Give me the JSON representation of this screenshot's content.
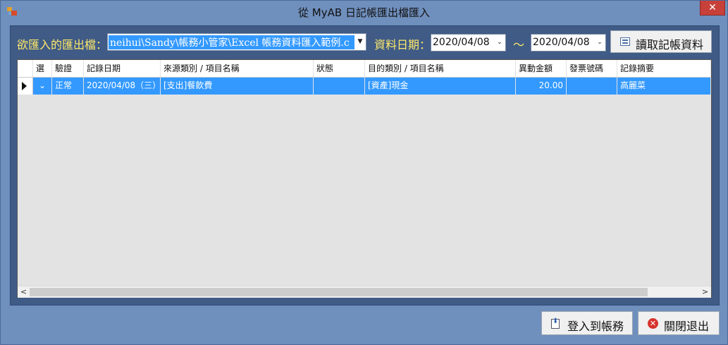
{
  "window": {
    "title": "從 MyAB 日記帳匯出檔匯入",
    "close_label": "✕"
  },
  "form": {
    "file_label": "欲匯入的匯出檔：",
    "file_value": "neihui\\Sandy\\帳務小管家\\Excel 帳務資料匯入範例.c",
    "date_label": "資料日期：",
    "date_from": "2020/04/08",
    "date_sep": "～",
    "date_to": "2020/04/08",
    "read_button": "讀取記帳資料"
  },
  "grid": {
    "columns": [
      "選",
      "驗證",
      "記錄日期",
      "來源類別 / 項目名稱",
      "狀態",
      "目的類別 / 項目名稱",
      "異動金額",
      "發票號碼",
      "記錄摘要"
    ],
    "rows": [
      {
        "select": "⌄",
        "verify": "正常",
        "date": "2020/04/08（三）",
        "source": "[支出]餐飲費",
        "status": "",
        "target": "[資產]現金",
        "amount": "20.00",
        "invoice": "",
        "memo": "高麗菜"
      }
    ]
  },
  "buttons": {
    "import": "登入到帳務",
    "exit": "關閉退出"
  },
  "colors": {
    "background": "#6f8fbd",
    "panel": "#3f5b86",
    "label_yellow": "#ffe96a",
    "selection": "#3399ff"
  }
}
